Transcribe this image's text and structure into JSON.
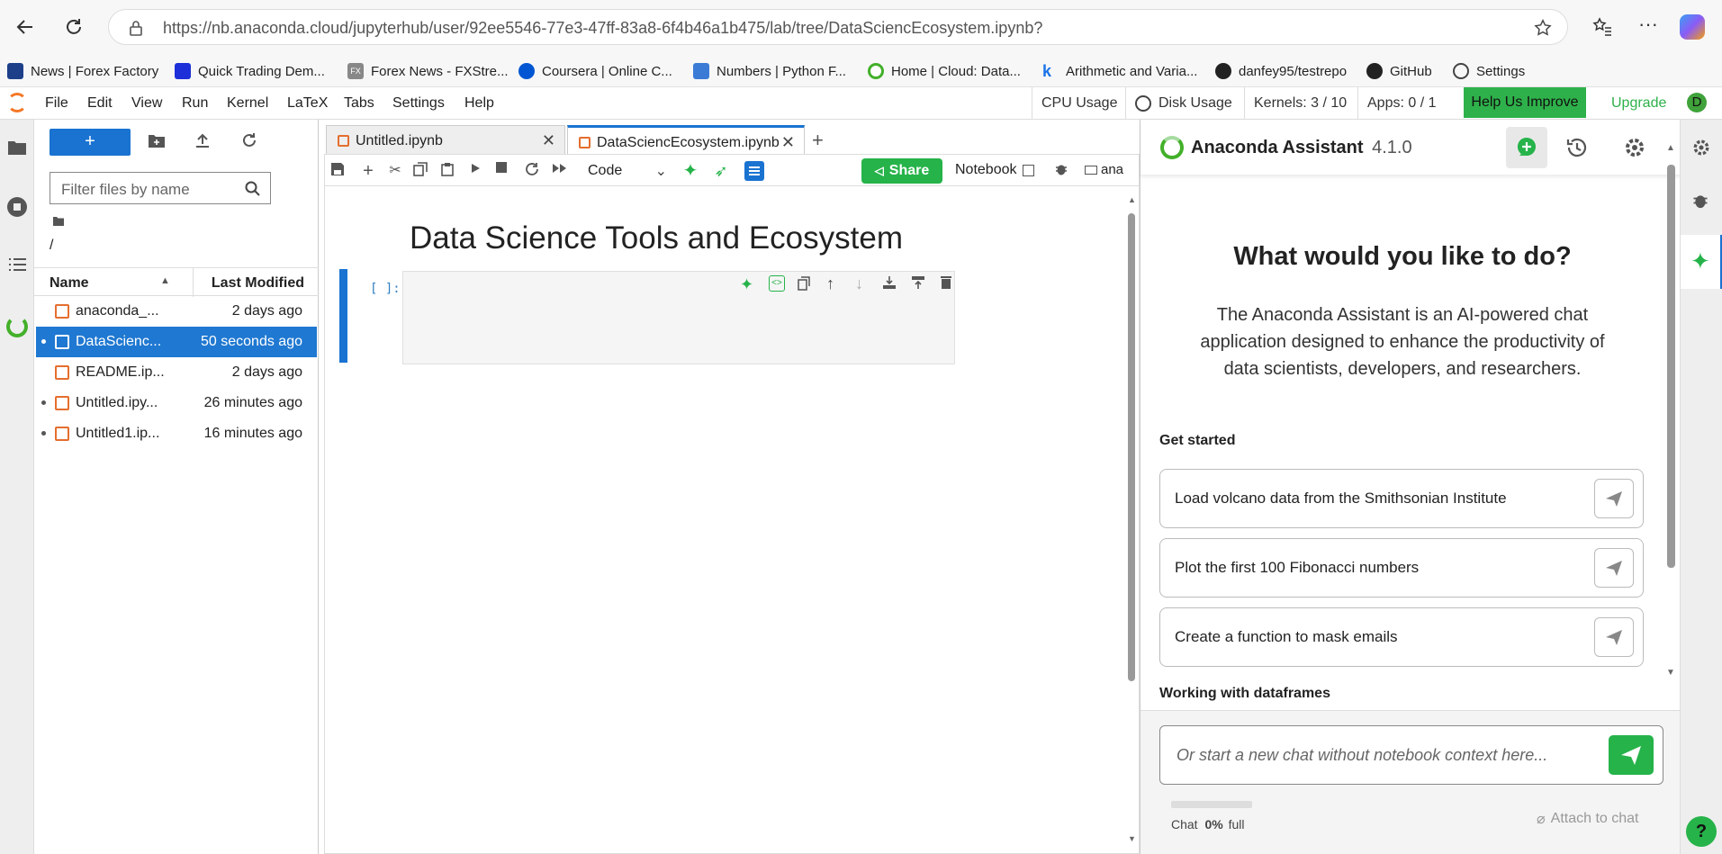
{
  "browser": {
    "url": "https://nb.anaconda.cloud/jupyterhub/user/92ee5546-77e3-47ff-83a8-6f4b46a1b475/lab/tree/DataSciencEcosystem.ipynb?",
    "bookmarks": [
      {
        "label": "News | Forex Factory",
        "color": "#1d3f8a"
      },
      {
        "label": "Quick Trading Dem...",
        "color": "#1c2fd8"
      },
      {
        "label": "Forex News - FXStre...",
        "color": "#888888"
      },
      {
        "label": "Coursera | Online C...",
        "color": "#0056d2"
      },
      {
        "label": "Numbers | Python F...",
        "color": "#3b7bd6"
      },
      {
        "label": "Home | Cloud: Data...",
        "color": "#43b02a"
      },
      {
        "label": "Arithmetic and Varia...",
        "color": "#1a73e8"
      },
      {
        "label": "danfey95/testrepo",
        "color": "#222222"
      },
      {
        "label": "GitHub",
        "color": "#222222"
      },
      {
        "label": "Settings",
        "color": "#444444"
      }
    ]
  },
  "menubar": {
    "items": [
      "File",
      "Edit",
      "View",
      "Run",
      "Kernel",
      "LaTeX",
      "Tabs",
      "Settings",
      "Help"
    ],
    "cpu_usage": "CPU Usage",
    "disk_usage": "Disk Usage",
    "kernels": "Kernels: 3 / 10",
    "apps": "Apps: 0 / 1",
    "help_improve": "Help Us Improve",
    "upgrade": "Upgrade",
    "user_initial": "D"
  },
  "filebrowser": {
    "new_label": "+",
    "filter_placeholder": "Filter files by name",
    "path": "/",
    "col_name": "Name",
    "col_modified": "Last Modified",
    "files": [
      {
        "name": "anaconda_...",
        "modified": "2 days ago",
        "running": false,
        "selected": false
      },
      {
        "name": "DataScienc...",
        "modified": "50 seconds ago",
        "running": true,
        "selected": true
      },
      {
        "name": "README.ip...",
        "modified": "2 days ago",
        "running": false,
        "selected": false
      },
      {
        "name": "Untitled.ipy...",
        "modified": "26 minutes ago",
        "running": true,
        "selected": false
      },
      {
        "name": "Untitled1.ip...",
        "modified": "16 minutes ago",
        "running": true,
        "selected": false
      }
    ]
  },
  "notebook": {
    "tabs": [
      {
        "label": "Untitled.ipynb",
        "active": false
      },
      {
        "label": "DataSciencEcosystem.ipynb",
        "active": true
      }
    ],
    "cell_type": "Code",
    "share_label": "Share",
    "notebook_label": "Notebook",
    "kernel_label": "ana",
    "heading": "Data Science Tools and Ecosystem",
    "cell_prompt": "[ ]:"
  },
  "assistant": {
    "title": "Anaconda Assistant",
    "version": "4.1.0",
    "heading": "What would you like to do?",
    "description": "The Anaconda Assistant is an AI-powered chat application designed to enhance the productivity of data scientists, developers, and researchers.",
    "get_started": "Get started",
    "suggestions": [
      "Load volcano data from the Smithsonian Institute",
      "Plot the first 100 Fibonacci numbers",
      "Create a function to mask emails"
    ],
    "section2": "Working with dataframes",
    "chat_placeholder": "Or start a new chat without notebook context here...",
    "chat_label": "Chat",
    "chat_percent": "0%",
    "chat_full": "full",
    "attach": "Attach to chat",
    "accent": "#26b34a"
  }
}
